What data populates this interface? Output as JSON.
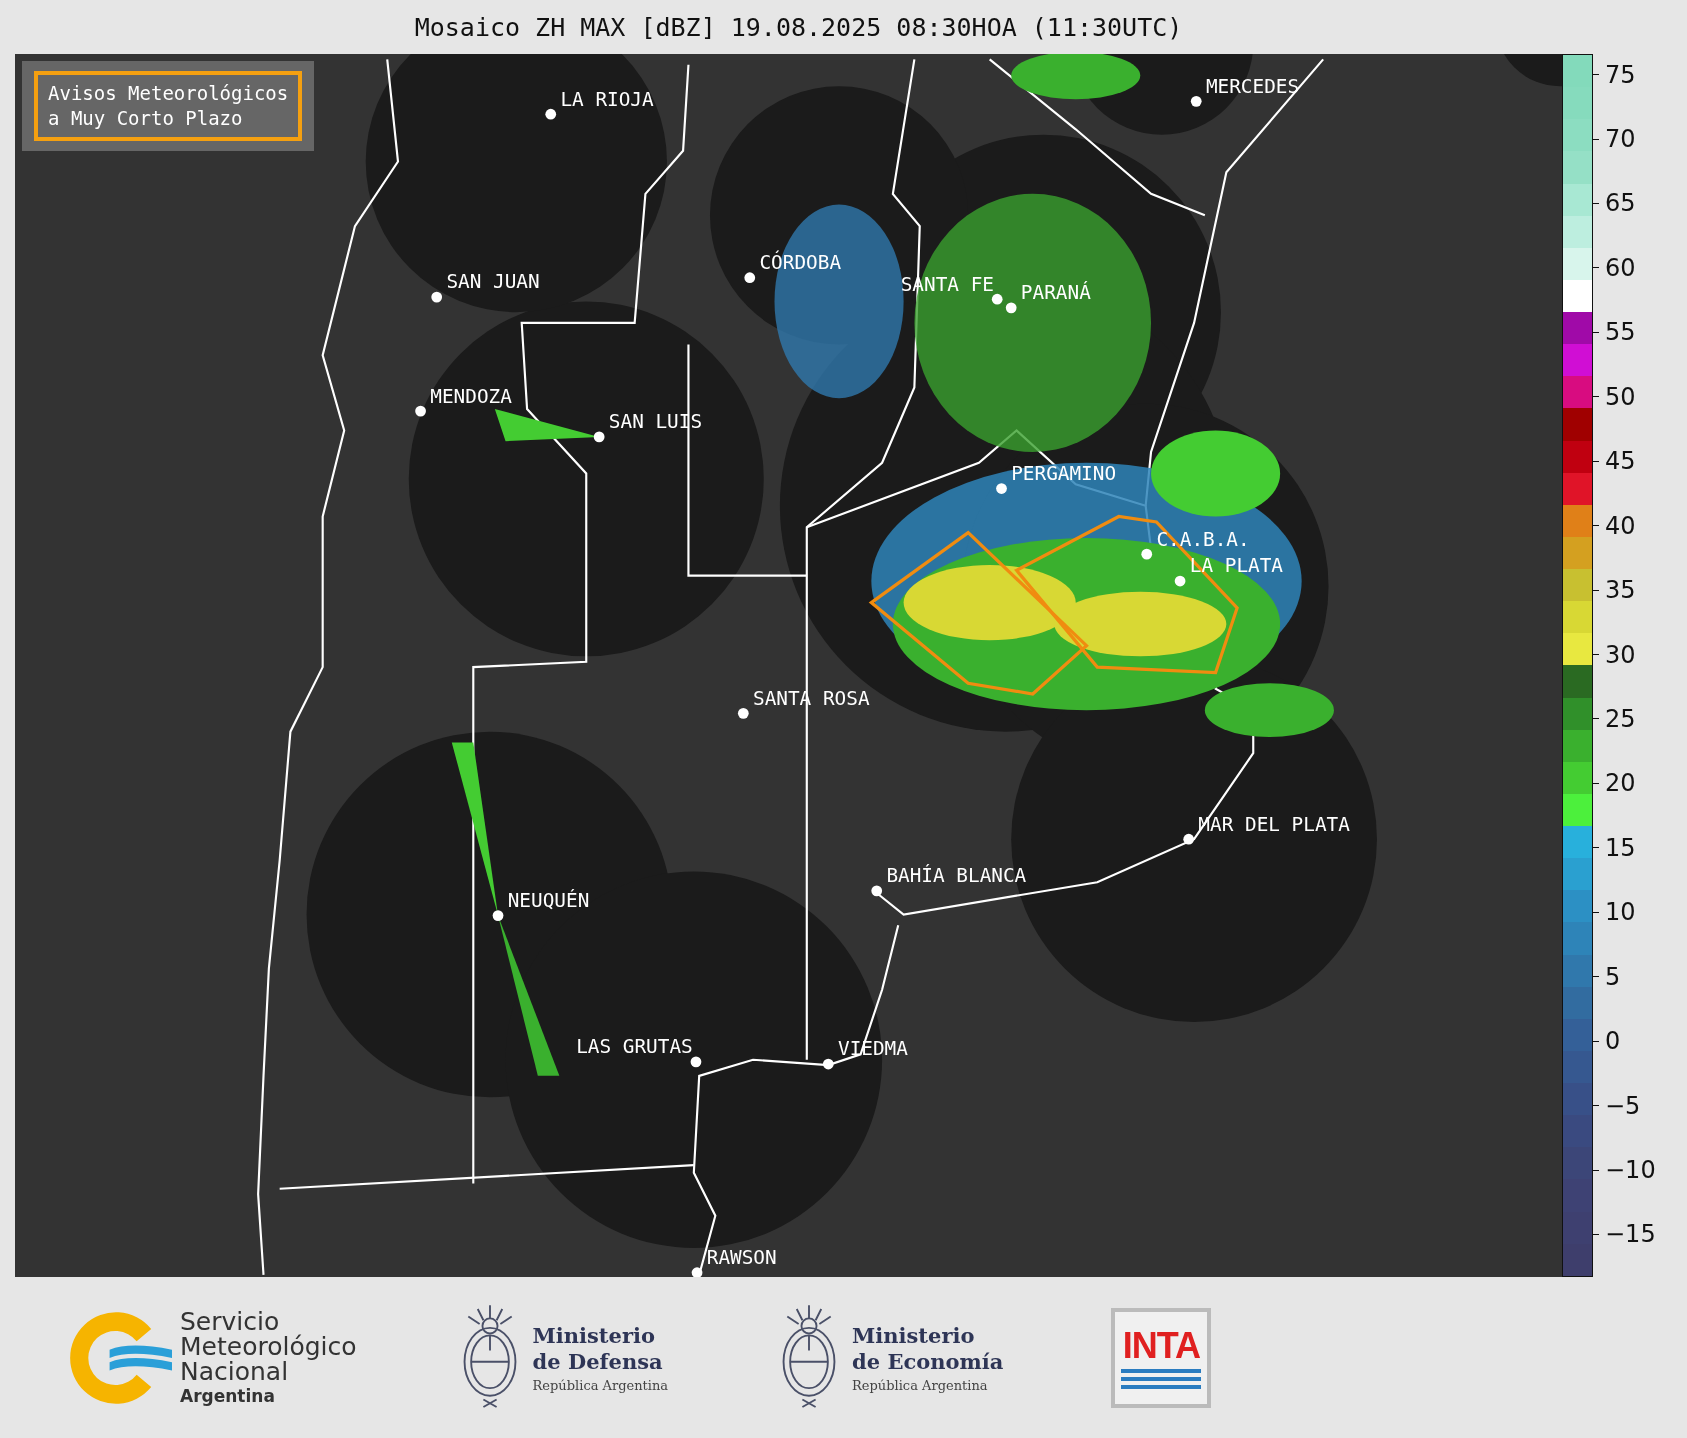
{
  "title": "Mosaico ZH MAX [dBZ] 19.08.2025 08:30HOA (11:30UTC)",
  "map": {
    "warning_legend": {
      "lines": [
        "Avisos Meteorológicos",
        "a Muy Corto Plazo"
      ]
    },
    "cities": [
      {
        "name": "LA RIOJA"
      },
      {
        "name": "MERCEDES"
      },
      {
        "name": "SAN JUAN"
      },
      {
        "name": "CÓRDOBA"
      },
      {
        "name": "SANTA FE"
      },
      {
        "name": "PARANÁ"
      },
      {
        "name": "MENDOZA"
      },
      {
        "name": "SAN LUIS"
      },
      {
        "name": "PERGAMINO"
      },
      {
        "name": "C.A.B.A."
      },
      {
        "name": "LA PLATA"
      },
      {
        "name": "SANTA ROSA"
      },
      {
        "name": "MAR DEL PLATA"
      },
      {
        "name": "BAHÍA BLANCA"
      },
      {
        "name": "NEUQUÉN"
      },
      {
        "name": "LAS GRUTAS"
      },
      {
        "name": "VIEDMA"
      },
      {
        "name": "RAWSON"
      }
    ]
  },
  "colorbar": {
    "segments": [
      {
        "color": "#83dabb"
      },
      {
        "color": "#86dbbd"
      },
      {
        "color": "#8cddc1"
      },
      {
        "color": "#95e0c6"
      },
      {
        "color": "#a8e8d3"
      },
      {
        "color": "#bdeedf"
      },
      {
        "color": "#d8f5ec"
      },
      {
        "color": "#ffffff"
      },
      {
        "color": "#a00aa8"
      },
      {
        "color": "#d00ed4"
      },
      {
        "color": "#d80c80"
      },
      {
        "color": "#a00000"
      },
      {
        "color": "#c00010"
      },
      {
        "color": "#e01428"
      },
      {
        "color": "#e08018"
      },
      {
        "color": "#d4a020"
      },
      {
        "color": "#c8c030"
      },
      {
        "color": "#d8d834"
      },
      {
        "color": "#e8e840"
      },
      {
        "color": "#2a6a22"
      },
      {
        "color": "#30902a"
      },
      {
        "color": "#3ab02e"
      },
      {
        "color": "#44cc32"
      },
      {
        "color": "#4cf03c"
      },
      {
        "color": "#28b0dc"
      },
      {
        "color": "#2aa0d0"
      },
      {
        "color": "#2c90c4"
      },
      {
        "color": "#2e84b8"
      },
      {
        "color": "#3078ac"
      },
      {
        "color": "#326ca0"
      },
      {
        "color": "#346098"
      },
      {
        "color": "#365890"
      },
      {
        "color": "#385088"
      },
      {
        "color": "#3a4a80"
      },
      {
        "color": "#3c4678"
      },
      {
        "color": "#3e4274"
      },
      {
        "color": "#3e4070"
      },
      {
        "color": "#3e3e6c"
      }
    ],
    "ticks": [
      "75",
      "70",
      "65",
      "60",
      "55",
      "50",
      "45",
      "40",
      "35",
      "30",
      "25",
      "20",
      "15",
      "10",
      "5",
      "0",
      "−5",
      "−10",
      "−15"
    ]
  },
  "footer": {
    "logos": [
      {
        "kind": "smn",
        "lines": [
          "Servicio",
          "Meteorológico",
          "Nacional"
        ],
        "subtitle": "Argentina"
      },
      {
        "kind": "ministry",
        "lines": [
          "Ministerio",
          "de Defensa"
        ],
        "subtitle": "República Argentina"
      },
      {
        "kind": "ministry",
        "lines": [
          "Ministerio",
          "de Economía"
        ],
        "subtitle": "República Argentina"
      },
      {
        "kind": "inta",
        "lines": [
          "INTA"
        ]
      }
    ]
  }
}
